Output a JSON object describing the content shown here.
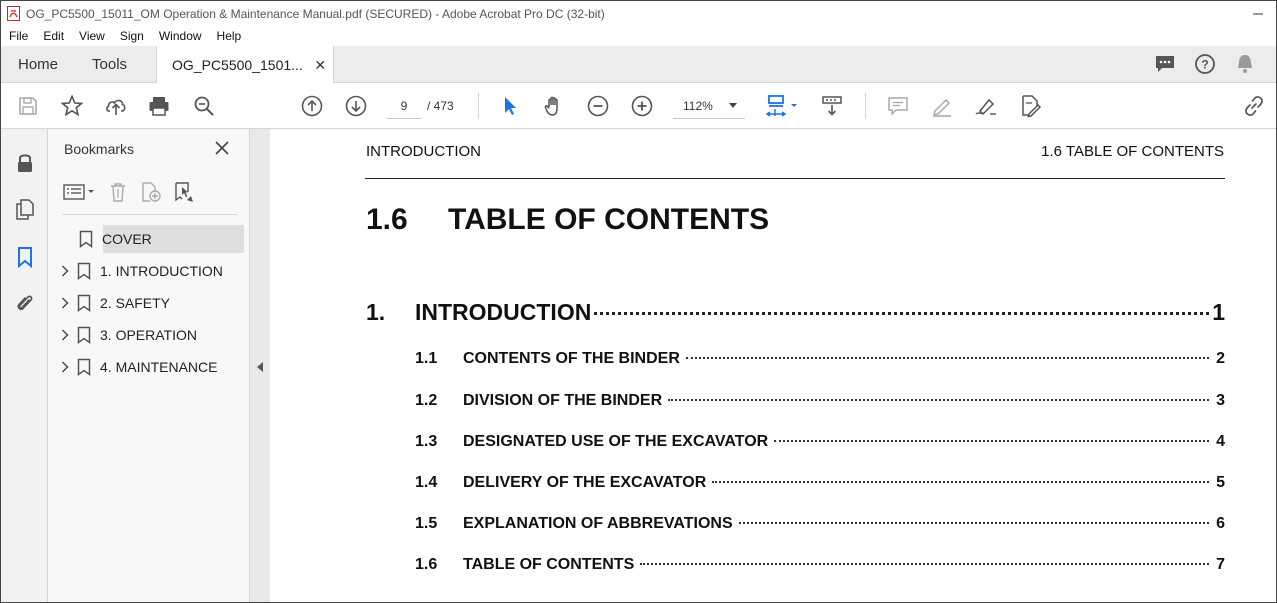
{
  "window": {
    "title": "OG_PC5500_15011_OM Operation & Maintenance Manual.pdf (SECURED) - Adobe Acrobat Pro DC (32-bit)"
  },
  "menu": [
    "File",
    "Edit",
    "View",
    "Sign",
    "Window",
    "Help"
  ],
  "tabs": {
    "home": "Home",
    "tools": "Tools",
    "document": "OG_PC5500_1501..."
  },
  "toolbar": {
    "current_page": "9",
    "page_total": "/ 473",
    "zoom": "112%"
  },
  "bookmarks": {
    "header": "Bookmarks",
    "items": [
      {
        "label": "COVER",
        "expandable": false,
        "selected": true
      },
      {
        "label": "1.  INTRODUCTION",
        "expandable": true,
        "selected": false
      },
      {
        "label": "2.  SAFETY",
        "expandable": true,
        "selected": false
      },
      {
        "label": "3.  OPERATION",
        "expandable": true,
        "selected": false
      },
      {
        "label": "4.  MAINTENANCE",
        "expandable": true,
        "selected": false
      }
    ]
  },
  "document": {
    "header_left": "INTRODUCTION",
    "header_right": "1.6 TABLE OF CONTENTS",
    "title_number": "1.6",
    "title_text": "TABLE OF CONTENTS",
    "toc_main": {
      "number": "1.",
      "label": "INTRODUCTION",
      "page": "1"
    },
    "toc_entries": [
      {
        "number": "1.1",
        "label": "CONTENTS OF THE BINDER",
        "page": "2"
      },
      {
        "number": "1.2",
        "label": "DIVISION OF THE BINDER",
        "page": "3"
      },
      {
        "number": "1.3",
        "label": "DESIGNATED USE OF THE EXCAVATOR",
        "page": "4"
      },
      {
        "number": "1.4",
        "label": "DELIVERY OF THE EXCAVATOR",
        "page": "5"
      },
      {
        "number": "1.5",
        "label": "EXPLANATION OF ABBREVATIONS",
        "page": "6"
      },
      {
        "number": "1.6",
        "label": "TABLE OF CONTENTS",
        "page": "7"
      }
    ]
  },
  "colors": {
    "accent_blue": "#1a73e8",
    "pdf_red": "#d9201f",
    "icon_gray": "#555555"
  }
}
